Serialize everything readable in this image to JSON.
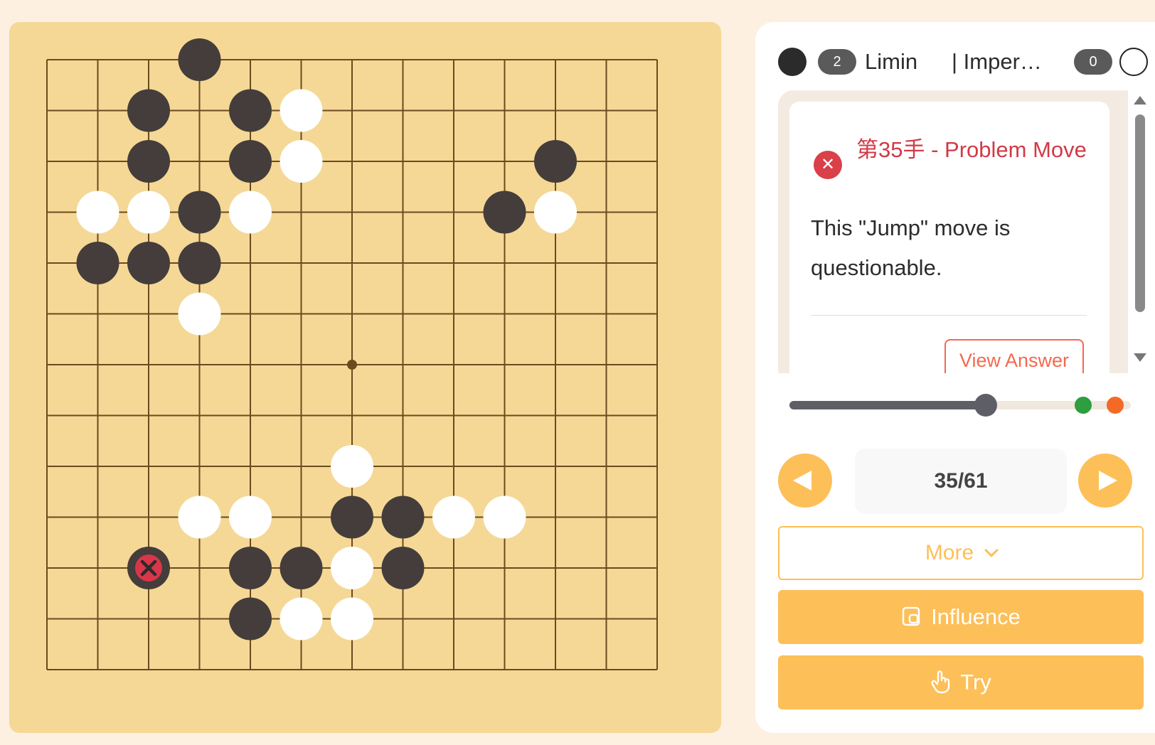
{
  "board": {
    "size": 13,
    "star_point": [
      6,
      6
    ],
    "colors": {
      "wood": "#f5d896",
      "line": "#6b4a1e",
      "black": "#443d3b",
      "white": "#ffffff",
      "mistake": "#d9364a"
    },
    "black_stones": [
      [
        3,
        0
      ],
      [
        2,
        1
      ],
      [
        4,
        1
      ],
      [
        2,
        2
      ],
      [
        4,
        2
      ],
      [
        10,
        2
      ],
      [
        3,
        3
      ],
      [
        9,
        3
      ],
      [
        1,
        4
      ],
      [
        2,
        4
      ],
      [
        3,
        4
      ],
      [
        6,
        9
      ],
      [
        7,
        9
      ],
      [
        4,
        10
      ],
      [
        5,
        10
      ],
      [
        7,
        10
      ],
      [
        4,
        11
      ]
    ],
    "white_stones": [
      [
        5,
        1
      ],
      [
        5,
        2
      ],
      [
        1,
        3
      ],
      [
        2,
        3
      ],
      [
        4,
        3
      ],
      [
        10,
        3
      ],
      [
        3,
        5
      ],
      [
        6,
        8
      ],
      [
        3,
        9
      ],
      [
        4,
        9
      ],
      [
        8,
        9
      ],
      [
        9,
        9
      ],
      [
        6,
        10
      ],
      [
        5,
        11
      ],
      [
        6,
        11
      ]
    ],
    "mistake_stone": [
      2,
      10
    ]
  },
  "players": {
    "black": {
      "name": "Limin",
      "captures": "2"
    },
    "white": {
      "name": "| Imper…",
      "captures": "0"
    }
  },
  "comment": {
    "title": "第35手 - Problem Move",
    "body": "This \"Jump\" move is questionable.",
    "view_answer": "View Answer",
    "status_icon": "close-icon"
  },
  "slider": {
    "position_fraction": 0.575,
    "markers": [
      {
        "fraction": 0.86,
        "color": "#2e9e3e"
      },
      {
        "fraction": 0.955,
        "color": "#f26a26"
      }
    ]
  },
  "navigation": {
    "counter": "35/61",
    "prev_icon": "triangle-left-icon",
    "next_icon": "triangle-right-icon"
  },
  "buttons": {
    "more": "More",
    "influence": "Influence",
    "try": "Try"
  },
  "theme": {
    "accent": "#fdbf58",
    "error": "#d23a47",
    "page_bg": "#fdf0e0"
  }
}
